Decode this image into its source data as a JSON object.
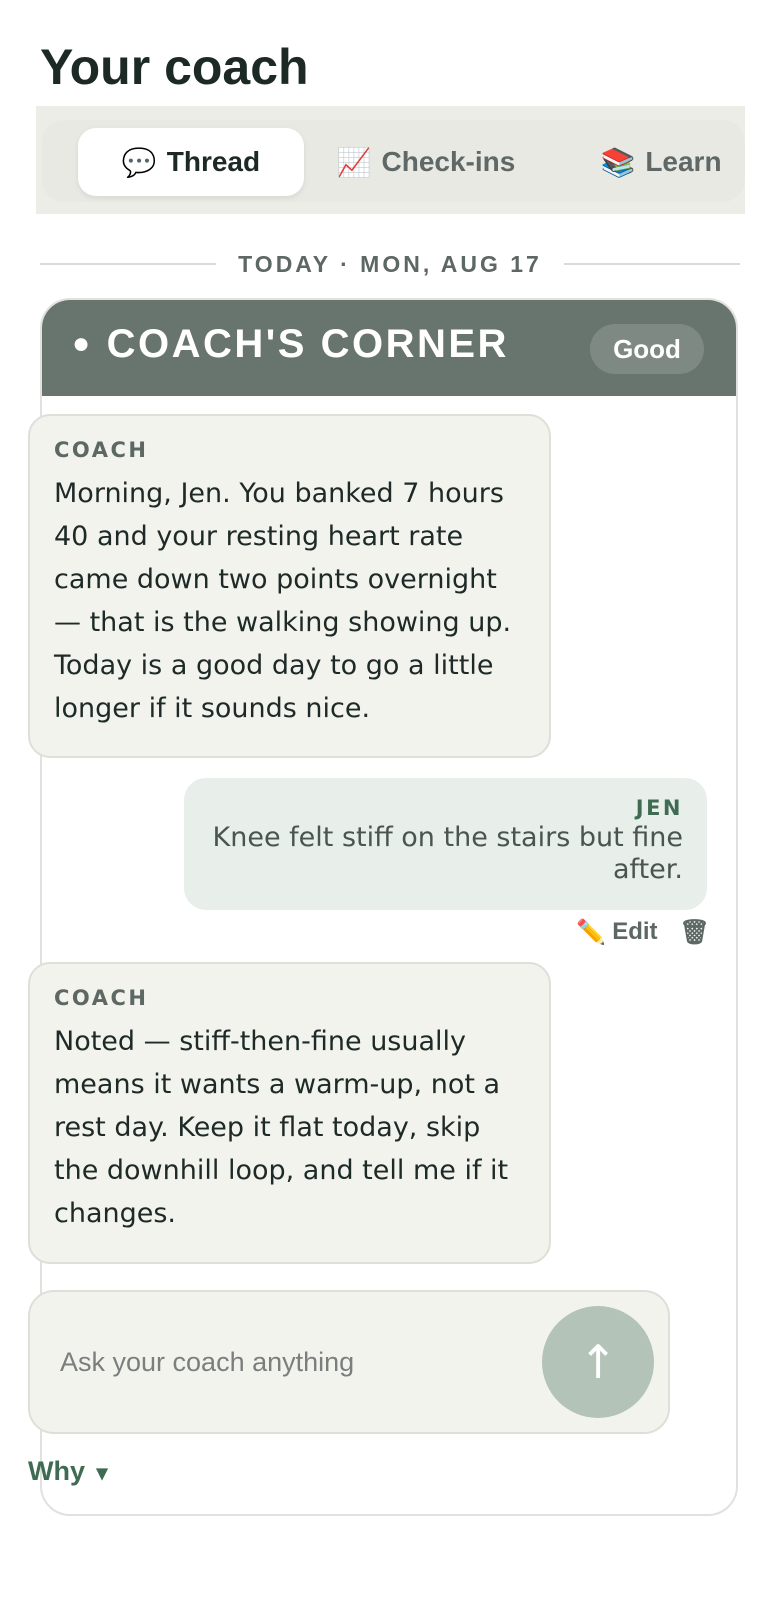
{
  "header": {
    "title": "Your coach"
  },
  "tabs": [
    {
      "icon": "💬",
      "label": "Thread",
      "active": true
    },
    {
      "icon": "📈",
      "label": "Check-ins",
      "active": false
    },
    {
      "icon": "📚",
      "label": "Learn",
      "active": false
    }
  ],
  "date_divider": "TODAY · MON, AUG 17",
  "card": {
    "dot": "●",
    "title": "COACH'S CORNER",
    "badge": "Good",
    "header_color": "#68746e"
  },
  "messages": [
    {
      "sender": "COACH",
      "text": "Morning, Jen. You banked 7 hours 40 and your resting heart rate came down two points overnight — that is the walking showing up. Today is a good day to go a little longer if it sounds nice."
    },
    {
      "sender": "JEN",
      "text": "Knee felt stiff on the stairs but fine after."
    },
    {
      "sender": "COACH",
      "text": "Noted — stiff-then-fine usually means it wants a warm-up, not a rest day. Keep it flat today, skip the downhill loop, and tell me if it changes."
    }
  ],
  "message_actions": {
    "edit_icon": "✏️",
    "edit_label": "Edit",
    "delete_icon": "🗑"
  },
  "composer": {
    "placeholder": "Ask your coach anything",
    "value": "",
    "send_icon": "↑"
  },
  "why": {
    "label": "Why",
    "caret": "▾"
  },
  "colors": {
    "accent_green": "#3f6b52",
    "send_button": "#b3c3b7",
    "bubble_bg": "#f2f3ed",
    "user_bubble_bg": "#e8eeea"
  }
}
